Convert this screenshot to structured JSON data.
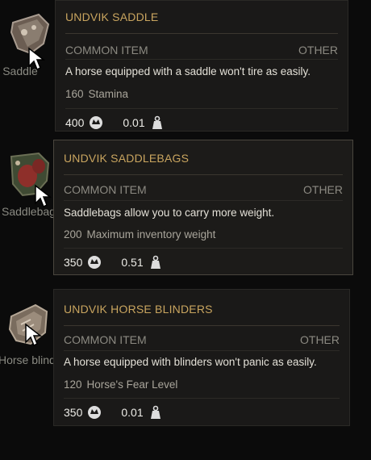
{
  "items": [
    {
      "slot_label": "Saddle",
      "title": "UNDVIK SADDLE",
      "rarity": "COMMON ITEM",
      "category": "OTHER",
      "description": "A horse equipped with a saddle won't tire as easily.",
      "stat_value": "160",
      "stat_name": "Stamina",
      "price": "400",
      "weight": "0.01"
    },
    {
      "slot_label": "Saddlebags",
      "title": "UNDVIK SADDLEBAGS",
      "rarity": "COMMON ITEM",
      "category": "OTHER",
      "description": "Saddlebags allow you to carry more weight.",
      "stat_value": "200",
      "stat_name": "Maximum inventory weight",
      "price": "350",
      "weight": "0.51"
    },
    {
      "slot_label": "Horse blinders",
      "title": "UNDVIK HORSE BLINDERS",
      "rarity": "COMMON ITEM",
      "category": "OTHER",
      "description": "A horse equipped with blinders won't panic as easily.",
      "stat_value": "120",
      "stat_name": "Horse's Fear Level",
      "price": "350",
      "weight": "0.01"
    }
  ],
  "icons": {
    "price": "crowns-coin-icon",
    "weight": "weight-icon"
  },
  "colors": {
    "title": "#c9a55f",
    "background": "#0b0b0b",
    "card": "#1a1918"
  }
}
